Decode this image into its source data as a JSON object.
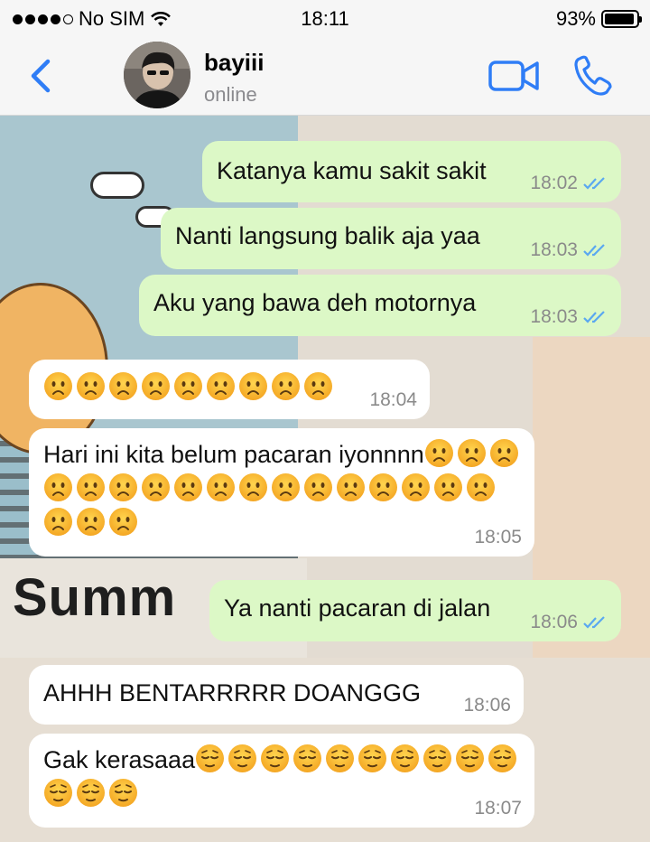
{
  "status_bar": {
    "carrier": "No SIM",
    "time": "18:11",
    "battery": "93%",
    "battery_level": 0.93
  },
  "header": {
    "contact_name": "bayiii",
    "presence": "online",
    "icons": [
      "chevron-left-icon",
      "video-icon",
      "phone-icon"
    ],
    "accent_color": "#2f7df6"
  },
  "messages": [
    {
      "dir": "out",
      "text": "Katanya kamu sakit sakit",
      "time": "18:02",
      "read": true
    },
    {
      "dir": "out",
      "text": "Nanti langsung balik aja yaa",
      "time": "18:03",
      "read": true
    },
    {
      "dir": "out",
      "text": "Aku yang bawa deh motornya",
      "time": "18:03",
      "read": true
    },
    {
      "dir": "in",
      "text": "☹️☹️☹️☹️☹️☹️☹️☹️☹️",
      "time": "18:04"
    },
    {
      "dir": "in",
      "text": "Hari ini kita belum pacaran iyonnnn☹️☹️☹️☹️☹️☹️☹️☹️☹️☹️☹️☹️☹️☹️☹️☹️☹️☹️☹️☹️",
      "time": "18:05"
    },
    {
      "dir": "out",
      "text": "Ya nanti pacaran di jalan",
      "time": "18:06",
      "read": true
    },
    {
      "dir": "in",
      "text": "AHHH BENTARRRRR DOANGGG",
      "time": "18:06"
    },
    {
      "dir": "in",
      "text": "Gak kerasaaa😔😔😔😔😔😔😔😔😔😔😔😔😔",
      "time": "18:07"
    }
  ],
  "colors": {
    "outgoing_bubble": "#dcf8c6",
    "incoming_bubble": "#ffffff",
    "read_tick": "#5aa8f0"
  }
}
